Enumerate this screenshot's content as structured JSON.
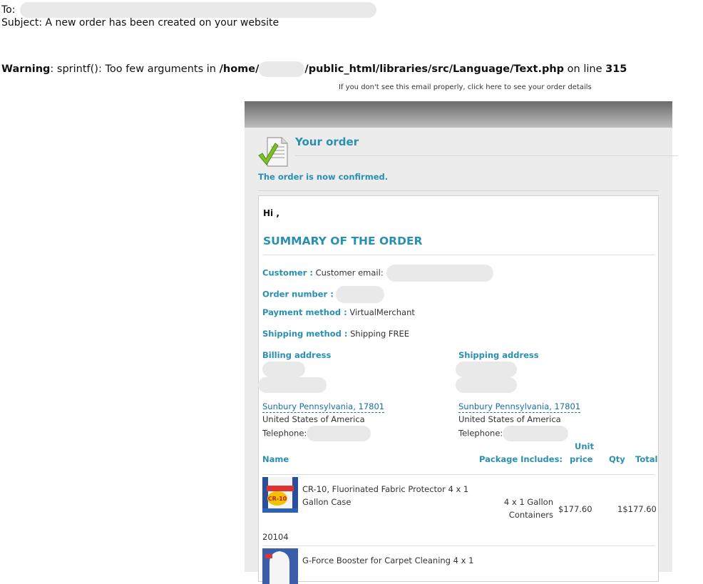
{
  "header": {
    "to_label": "To:",
    "subject": "Subject: A new order has been created on your website"
  },
  "warning": {
    "label": "Warning",
    "message": ": sprintf(): Too few arguments in ",
    "path_start": "/home/",
    "path_end": "/public_html/libraries/src/Language/Text.php",
    "on_line": " on line ",
    "line_no": "315"
  },
  "view_link": "If you don't see this email properly, click here to see your order details",
  "order": {
    "title": "Your order",
    "confirmed": "The order is now confirmed."
  },
  "summary": {
    "greeting": "Hi ,",
    "title": "SUMMARY OF THE ORDER",
    "customer_label": "Customer :",
    "customer_value": "Customer email:",
    "order_number_label": "Order number :",
    "payment_label": "Payment method :",
    "payment_value": "VirtualMerchant",
    "shipping_label": "Shipping method :",
    "shipping_value": "Shipping FREE"
  },
  "billing": {
    "title": "Billing address",
    "city": "Sunbury Pennsylvania, 17801",
    "country": "United States of America",
    "phone_label": "Telephone:"
  },
  "shipping_address": {
    "title": "Shipping address",
    "city": "Sunbury Pennsylvania, 17801",
    "country": "United States of America",
    "phone_label": "Telephone:"
  },
  "table": {
    "col_name": "Name",
    "col_package": "Package Includes:",
    "col_unit_1": "Unit",
    "col_unit_2": "price",
    "col_qty": "Qty",
    "col_total": "Total"
  },
  "products": [
    {
      "name_1": "CR-10, Fluorinated Fabric Protector 4 x 1",
      "name_2": "Gallon Case",
      "package_1": "4 x 1 Gallon",
      "package_2": "Containers",
      "unit_price": "$177.60",
      "qty_total": "1$177.60",
      "sku": "20104",
      "img_label": "CR-10"
    },
    {
      "name_1": "G-Force Booster for Carpet Cleaning 4 x 1"
    }
  ]
}
